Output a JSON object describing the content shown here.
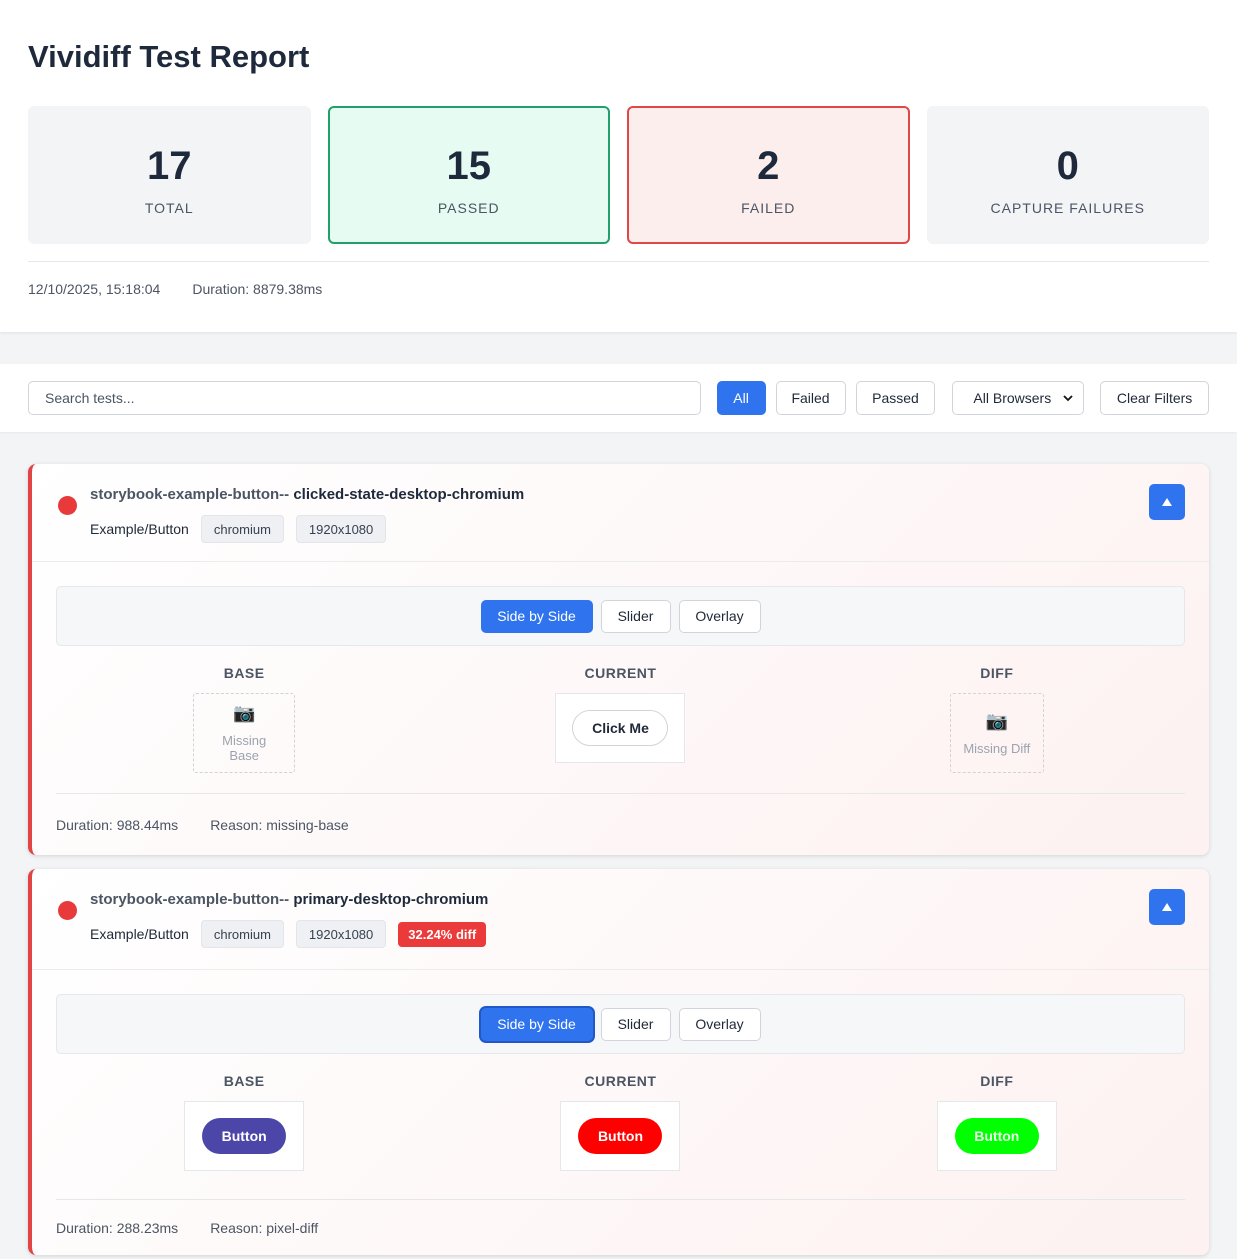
{
  "header": {
    "title": "Vividiff Test Report",
    "stats": {
      "total": {
        "value": "17",
        "label": "TOTAL"
      },
      "passed": {
        "value": "15",
        "label": "PASSED"
      },
      "failed": {
        "value": "2",
        "label": "FAILED"
      },
      "capture_failures": {
        "value": "0",
        "label": "CAPTURE FAILURES"
      }
    },
    "timestamp": "12/10/2025, 15:18:04",
    "duration": "Duration: 8879.38ms"
  },
  "toolbar": {
    "search_placeholder": "Search tests...",
    "filters": [
      "All",
      "Failed",
      "Passed"
    ],
    "browser_select": "All Browsers",
    "clear_label": "Clear Filters"
  },
  "tests": [
    {
      "name_prefix": "storybook-example-button--",
      "name_suffix": " clicked-state-desktop-chromium",
      "story": "Example/Button",
      "browser": "chromium",
      "resolution": "1920x1080",
      "view_modes": [
        "Side by Side",
        "Slider",
        "Overlay"
      ],
      "base_label": "BASE",
      "current_label": "CURRENT",
      "diff_label": "DIFF",
      "base_missing": "Missing Base",
      "current_button": "Click Me",
      "diff_missing": "Missing Diff",
      "duration": "Duration: 988.44ms",
      "reason": "Reason: missing-base"
    },
    {
      "name_prefix": "storybook-example-button--",
      "name_suffix": " primary-desktop-chromium",
      "story": "Example/Button",
      "browser": "chromium",
      "resolution": "1920x1080",
      "diff_badge": "32.24% diff",
      "view_modes": [
        "Side by Side",
        "Slider",
        "Overlay"
      ],
      "base_label": "BASE",
      "current_label": "CURRENT",
      "diff_label": "DIFF",
      "base_button": "Button",
      "current_button": "Button",
      "diff_button": "Button",
      "duration": "Duration: 288.23ms",
      "reason": "Reason: pixel-diff"
    }
  ],
  "colors": {
    "accent": "#2f74ee",
    "fail": "#e04444",
    "pass": "#22a06b",
    "base_button": "#4b46a8",
    "current_button": "#ff0000",
    "diff_button": "#00ff00"
  },
  "icons": {
    "collapse": "chevron-up-icon",
    "missing": "camera-icon",
    "select": "chevron-down-icon"
  }
}
